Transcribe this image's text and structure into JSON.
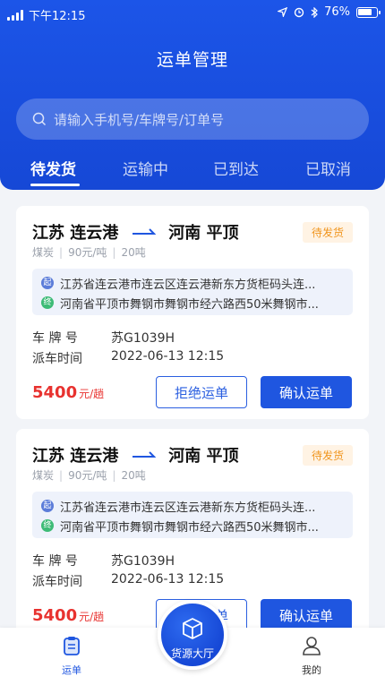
{
  "status_bar": {
    "time": "下午12:15",
    "battery": "76%"
  },
  "header": {
    "title": "运单管理",
    "search_placeholder": "请输入手机号/车牌号/订单号",
    "tabs": [
      {
        "label": "待发货",
        "active": true
      },
      {
        "label": "运输中",
        "active": false
      },
      {
        "label": "已到达",
        "active": false
      },
      {
        "label": "已取消",
        "active": false
      }
    ]
  },
  "orders": [
    {
      "origin": "江苏 连云港",
      "destination": "河南 平顶",
      "status": "待发货",
      "cargo": "煤炭",
      "unit_price": "90元/吨",
      "weight": "20吨",
      "start_marker": "起",
      "end_marker": "终",
      "start_address": "江苏省连云港市连云区连云港新东方货柜码头连...",
      "end_address": "河南省平顶市舞钢市舞钢市经六路西50米舞钢市...",
      "plate_label": "车 牌 号",
      "plate": "苏G1039H",
      "dispatch_label": "派车时间",
      "dispatch_time": "2022-06-13  12:15",
      "price": "5400",
      "price_unit": "元/趟",
      "reject_label": "拒绝运单",
      "confirm_label": "确认运单"
    },
    {
      "origin": "江苏 连云港",
      "destination": "河南 平顶",
      "status": "待发货",
      "cargo": "煤炭",
      "unit_price": "90元/吨",
      "weight": "20吨",
      "start_marker": "起",
      "end_marker": "终",
      "start_address": "江苏省连云港市连云区连云港新东方货柜码头连...",
      "end_address": "河南省平顶市舞钢市舞钢市经六路西50米舞钢市...",
      "plate_label": "车 牌 号",
      "plate": "苏G1039H",
      "dispatch_label": "派车时间",
      "dispatch_time": "2022-06-13  12:15",
      "price": "5400",
      "price_unit": "元/趟",
      "reject_label": "拒绝运单",
      "confirm_label": "确认运单"
    }
  ],
  "bottom_nav": {
    "left": {
      "label": "运单",
      "icon": "clipboard-icon",
      "active": true
    },
    "center": {
      "label": "货源大厅",
      "icon": "box-icon"
    },
    "right": {
      "label": "我的",
      "icon": "user-icon",
      "active": false
    }
  },
  "colors": {
    "primary": "#1f56e0",
    "price_red": "#e8322f",
    "badge_orange": "#f0951e"
  }
}
